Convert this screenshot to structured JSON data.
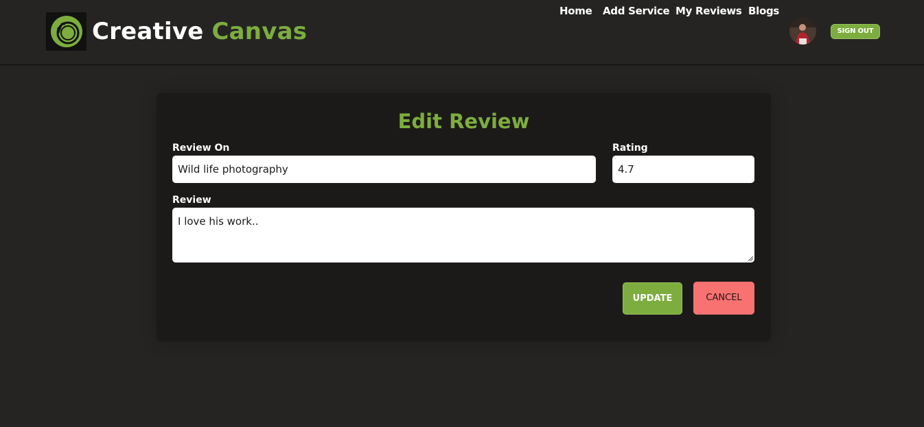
{
  "brand": {
    "name_part1": "Creative",
    "name_part2": "Canvas"
  },
  "nav": {
    "home": "Home",
    "add_service": "Add Service",
    "my_reviews": "My Reviews",
    "blogs": "Blogs",
    "sign_out": "SIGN OUT"
  },
  "form": {
    "title": "Edit Review",
    "review_on_label": "Review On",
    "review_on_value": "Wild life photography",
    "rating_label": "Rating",
    "rating_value": "4.7",
    "review_label": "Review",
    "review_value": "I love his work..",
    "update_label": "UPDATE",
    "cancel_label": "CANCEL"
  },
  "colors": {
    "accent": "#7cad3e",
    "background": "#252423",
    "card": "#1c1a19",
    "cancel": "#f87272"
  },
  "icons": {
    "logo": "camera-lens-icon",
    "avatar": "user-avatar-photo"
  }
}
